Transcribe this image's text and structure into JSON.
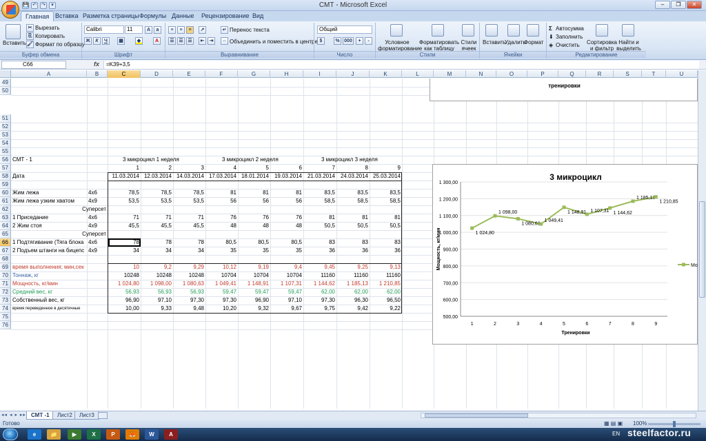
{
  "window": {
    "title": "СМТ - Microsoft Excel",
    "controls": [
      "–",
      "❐",
      "✕"
    ]
  },
  "quick_access": [
    "💾",
    "↶",
    "↷",
    "▾"
  ],
  "tabs": [
    "Главная",
    "Вставка",
    "Разметка страницы",
    "Формулы",
    "Данные",
    "Рецензирование",
    "Вид"
  ],
  "ribbon": {
    "paste": "Вставить",
    "cut": "Вырезать",
    "copy": "Копировать",
    "format_painter": "Формат по образцу",
    "clipboard_group": "Буфер обмена",
    "font_name": "Calibri",
    "font_size": "11",
    "font_group": "Шрифт",
    "bold": "Ж",
    "italic": "К",
    "underline": "Ч",
    "wrap": "Перенос текста",
    "merge": "Объединить и поместить в центре",
    "align_group": "Выравнивание",
    "number_format": "Общий",
    "number_group": "Число",
    "percent": "%",
    "thousands": "000",
    "cond_format": "Условное форматирование",
    "format_table": "Форматировать как таблицу",
    "cell_styles": "Стили ячеек",
    "styles_group": "Стили",
    "insert": "Вставить",
    "delete": "Удалить",
    "format": "Формат",
    "cells_group": "Ячейки",
    "autosum": "Автосумма",
    "fill": "Заполнить",
    "clear": "Очистить",
    "sort": "Сортировка и фильтр",
    "find": "Найти и выделить",
    "editing_group": "Редактирование"
  },
  "formula_bar": {
    "cell": "C66",
    "fx": "fx",
    "formula": "=K39+3,5"
  },
  "columns": [
    "A",
    "B",
    "C",
    "D",
    "E",
    "F",
    "G",
    "H",
    "I",
    "J",
    "K",
    "L",
    "M",
    "N",
    "O",
    "P",
    "Q",
    "R",
    "S",
    "T",
    "U"
  ],
  "rows": [
    "49",
    "50",
    "51",
    "52",
    "53",
    "54",
    "55",
    "56",
    "57",
    "58",
    "59",
    "60",
    "61",
    "62",
    "63",
    "64",
    "65",
    "66",
    "67",
    "68",
    "69",
    "70",
    "71",
    "72",
    "73",
    "74",
    "75",
    "76"
  ],
  "cells": {
    "r56a": "СМТ - 1",
    "mc1": "3 микроцикл 1 неделя",
    "mc2": "3 микроцикл 2 неделя",
    "mc3": "3 микроцикл 3 неделя",
    "nums": [
      "1",
      "2",
      "3",
      "4",
      "5",
      "6",
      "7",
      "8",
      "9"
    ],
    "date_label": "Дата",
    "dates": [
      "11.03.2014",
      "12.03.2014",
      "14.03.2014",
      "17.03.2014",
      "18.01.2014",
      "19.03.2014",
      "21.03.2014",
      "24.03.2014",
      "25.03.2014"
    ],
    "r60a": "Жим лежа",
    "r60b": "4х6",
    "r60": [
      "78,5",
      "78,5",
      "78,5",
      "81",
      "81",
      "81",
      "83,5",
      "83,5",
      "83,5"
    ],
    "r61a": "Жим лежа узким хватом",
    "r61b": "4х9",
    "r61": [
      "53,5",
      "53,5",
      "53,5",
      "56",
      "56",
      "56",
      "58,5",
      "58,5",
      "58,5"
    ],
    "r62a": "Суперсет",
    "r63a": "1  Приседание",
    "r63b": "4х6",
    "r63": [
      "71",
      "71",
      "71",
      "76",
      "76",
      "76",
      "81",
      "81",
      "81"
    ],
    "r64a": "2  Жим стоя",
    "r64b": "4х9",
    "r64": [
      "45,5",
      "45,5",
      "45,5",
      "48",
      "48",
      "48",
      "50,5",
      "50,5",
      "50,5"
    ],
    "r65a": "Суперсет",
    "r66a": "1 Подтягивание (Тяга блока",
    "r66b": "4х6",
    "r66": [
      "78",
      "78",
      "78",
      "80,5",
      "80,5",
      "80,5",
      "83",
      "83",
      "83"
    ],
    "r67a": "2 Подъем штанги на бицепс",
    "r67b": "4х9",
    "r67": [
      "34",
      "34",
      "34",
      "35",
      "35",
      "35",
      "36",
      "36",
      "36"
    ],
    "r69a": "время выполнения; мин,сек",
    "r69": [
      "10",
      "9,2",
      "9,29",
      "10,12",
      "9,19",
      "9,4",
      "9,45",
      "9,25",
      "9,13"
    ],
    "r70a": "Тоннаж, кг",
    "r70": [
      "10248",
      "10248",
      "10248",
      "10704",
      "10704",
      "10704",
      "11160",
      "11160",
      "11160"
    ],
    "r71a": "Мощность, кг/мин",
    "r71": [
      "1 024,80",
      "1 098,00",
      "1 080,63",
      "1 049,41",
      "1 148,91",
      "1 107,31",
      "1 144,62",
      "1 185,13",
      "1 210,85"
    ],
    "r72a": "Средний вес, кг",
    "r72": [
      "56,93",
      "56,93",
      "56,93",
      "59,47",
      "59,47",
      "59,47",
      "62,00",
      "62,00",
      "62,00"
    ],
    "r73a": "Собственный вес, кг",
    "r73": [
      "96,90",
      "97,10",
      "97,30",
      "97,30",
      "96,90",
      "97,10",
      "97,30",
      "96,30",
      "96,50"
    ],
    "r74a": "время переведенное в десятичные",
    "r74": [
      "10,00",
      "9,33",
      "9,48",
      "10,20",
      "9,32",
      "9,67",
      "9,75",
      "9,42",
      "9,22"
    ]
  },
  "sheets": [
    "СМТ -1",
    "Лист2",
    "Лист3"
  ],
  "sheet_nav": [
    "◂◂",
    "◂",
    "▸",
    "▸▸"
  ],
  "status": {
    "ready": "Готово",
    "zoom": "100%"
  },
  "taskbar": {
    "lang": "EN",
    "watermark": "steelfactor.ru",
    "apps": [
      "e",
      "📁",
      "▶",
      "X",
      "P",
      "🦊",
      "W",
      "A"
    ]
  },
  "colors": {
    "accent": "#9bbb59",
    "red": "#c0392b",
    "green": "#1f9d55",
    "blue": "#3e66a8"
  },
  "chart_top": {
    "xlabel": "тренировки"
  },
  "chart_data": {
    "type": "line",
    "title": "3 микроцикл",
    "xlabel": "Тренировки",
    "ylabel": "Мощность, кг/мин",
    "categories": [
      "1",
      "2",
      "3",
      "4",
      "5",
      "6",
      "7",
      "8",
      "9"
    ],
    "series": [
      {
        "name": "Мо",
        "values": [
          1024.8,
          1098.0,
          1080.63,
          1049.41,
          1148.91,
          1107.31,
          1144.62,
          1185.13,
          1210.85
        ]
      }
    ],
    "data_labels": [
      "1 024,80",
      "1 098,00",
      "1 080,63",
      "1 049,41",
      "1 148,91",
      "1 107,31",
      "1 144,62",
      "1 185,13",
      "1 210,85"
    ],
    "yticks": [
      "500,00",
      "600,00",
      "700,00",
      "800,00",
      "900,00",
      "1 000,00",
      "1 100,00",
      "1 200,00",
      "1 300,00"
    ],
    "ylim": [
      500,
      1300
    ],
    "legend": "right"
  }
}
